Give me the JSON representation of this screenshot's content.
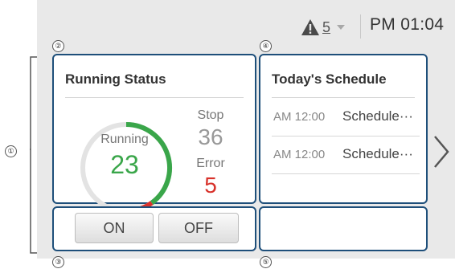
{
  "topbar": {
    "warning_count": "5",
    "clock": "PM 01:04"
  },
  "callouts": [
    "①",
    "②",
    "③",
    "④",
    "⑤"
  ],
  "running_status": {
    "title": "Running Status",
    "running_label": "Running",
    "running_value": "23",
    "stop_label": "Stop",
    "stop_value": "36",
    "error_label": "Error",
    "error_value": "5",
    "gauge": {
      "running": 23,
      "stop": 36,
      "error": 5
    }
  },
  "controls": {
    "on_label": "ON",
    "off_label": "OFF"
  },
  "schedule": {
    "title": "Today's Schedule",
    "items": [
      {
        "time": "AM 12:00",
        "name": "Schedule···"
      },
      {
        "time": "AM 12:00",
        "name": "Schedule···"
      }
    ]
  },
  "colors": {
    "panel_border": "#1e4f7a",
    "running": "#3aa64a",
    "error": "#d8322b",
    "stop_track": "#e3e3e3"
  },
  "icons": {
    "warning": "warning-triangle-icon",
    "dropdown": "caret-down-icon",
    "next": "chevron-right-icon"
  }
}
